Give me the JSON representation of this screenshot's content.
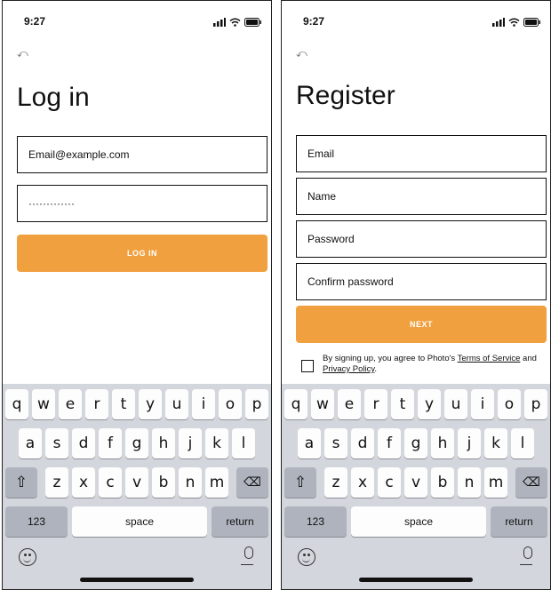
{
  "login": {
    "time": "9:27",
    "back": "⤺",
    "title": "Log in",
    "email_value": "Email@example.com",
    "password_value": "·············",
    "button": "LOG IN"
  },
  "register": {
    "time": "9:27",
    "back": "⤺",
    "title": "Register",
    "fields": [
      "Email",
      "Name",
      "Password",
      "Confirm password"
    ],
    "button": "NEXT",
    "terms_prefix": "By signing up, you agree to Photo's ",
    "terms_link": "Terms of Service",
    "terms_mid": " and ",
    "privacy_link": "Privacy Policy",
    "terms_suffix": "."
  },
  "keyboard": {
    "row1": [
      "q",
      "w",
      "e",
      "r",
      "t",
      "y",
      "u",
      "i",
      "o",
      "p"
    ],
    "row2": [
      "a",
      "s",
      "d",
      "f",
      "g",
      "h",
      "j",
      "k",
      "l"
    ],
    "row3": [
      "z",
      "x",
      "c",
      "v",
      "b",
      "n",
      "m"
    ],
    "shift": "⇧",
    "delete": "⌫",
    "numbers": "123",
    "space": "space",
    "return": "return"
  }
}
